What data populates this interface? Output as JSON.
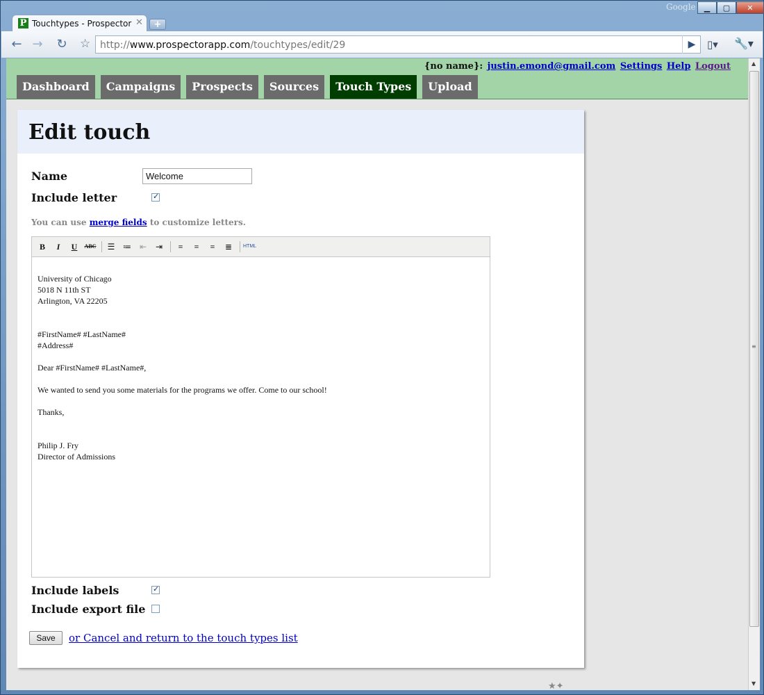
{
  "window": {
    "google_label": "Google",
    "tab_title": "Touchtypes - Prospector",
    "favicon_letter": "P",
    "url_prefix": "http://",
    "url_domain": "www.prospectorapp.com",
    "url_path": "/touchtypes/edit/29"
  },
  "header": {
    "user_prefix": "{no name}:",
    "email": "justin.emond@gmail.com",
    "settings": "Settings",
    "help": "Help",
    "logout": "Logout"
  },
  "nav": {
    "items": [
      "Dashboard",
      "Campaigns",
      "Prospects",
      "Sources",
      "Touch Types",
      "Upload"
    ],
    "active": "Touch Types"
  },
  "page": {
    "title": "Edit touch",
    "name_label": "Name",
    "name_value": "Welcome",
    "include_letter_label": "Include letter",
    "include_letter_checked": true,
    "hint_prefix": "You can use",
    "hint_link": "merge fields",
    "hint_suffix": "to customize letters.",
    "toolbar_buttons": [
      "B",
      "I",
      "U",
      "ABC",
      "bullet-list",
      "numbered-list",
      "outdent",
      "indent",
      "align-left",
      "align-center",
      "align-right",
      "justify",
      "HTML"
    ],
    "letter_text": "University of Chicago\n5018 N 11th ST\nArlington, VA 22205\n\n\n#FirstName# #LastName#\n#Address#\n\nDear #FirstName# #LastName#,\n\nWe wanted to send you some materials for the programs we offer. Come to our school!\n\nThanks,\n\n\nPhilip J. Fry\nDirector of Admissions",
    "include_labels_label": "Include labels",
    "include_labels_checked": true,
    "include_export_label": "Include export file",
    "include_export_checked": false,
    "save_label": "Save",
    "cancel_label": "or Cancel and return to the touch types list"
  }
}
